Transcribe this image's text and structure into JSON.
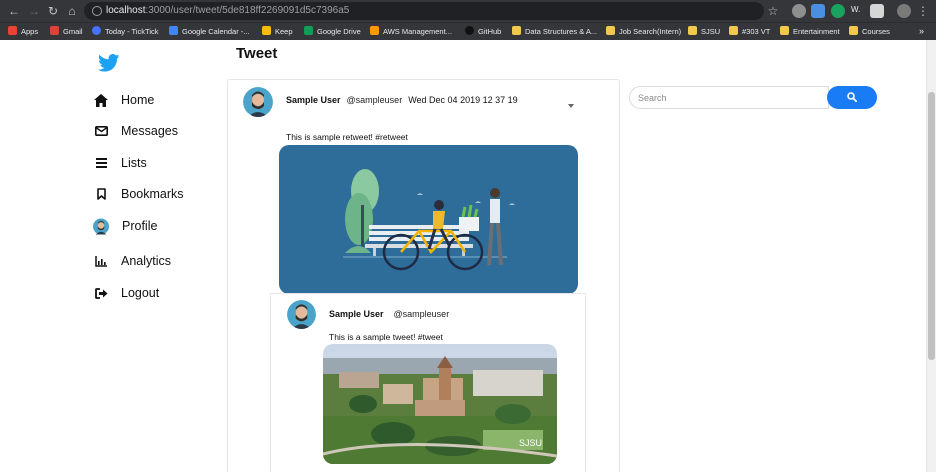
{
  "browser": {
    "url_host": "localhost",
    "url_path": ":3000/user/tweet/5de818ff2269091d5c7396a5",
    "extension_letter": "W.",
    "bookmarks": [
      "Apps",
      "Gmail",
      "Today - TickTick",
      "Google Calendar -...",
      "Keep",
      "Google Drive",
      "AWS Management...",
      "GitHub",
      "Data Structures & A...",
      "Job Search(Intern)",
      "SJSU",
      "#303 VT",
      "Entertainment",
      "Courses"
    ],
    "overflow": "»"
  },
  "sidebar": {
    "items": [
      {
        "label": "Home",
        "icon": "home-icon"
      },
      {
        "label": "Messages",
        "icon": "envelope-icon"
      },
      {
        "label": "Lists",
        "icon": "list-icon"
      },
      {
        "label": "Bookmarks",
        "icon": "bookmark-icon"
      },
      {
        "label": "Profile",
        "icon": "avatar"
      },
      {
        "label": "Analytics",
        "icon": "bar-chart-icon"
      },
      {
        "label": "Logout",
        "icon": "logout-icon"
      }
    ]
  },
  "header": {
    "title": "Tweet"
  },
  "tweet": {
    "name": "Sample User",
    "handle": "@sampleuser",
    "date": "Wed Dec 04 2019 12 37 19",
    "text": "This is sample retweet! #retweet"
  },
  "quoted": {
    "name": "Sample User",
    "handle": "@sampleuser",
    "text": "This is a sample tweet! #tweet",
    "image_caption": "SJSU"
  },
  "search": {
    "placeholder": "Search"
  },
  "colors": {
    "accent": "#1a7cf5",
    "twitter": "#1da1f2",
    "illustration_bg": "#2e6d99"
  }
}
